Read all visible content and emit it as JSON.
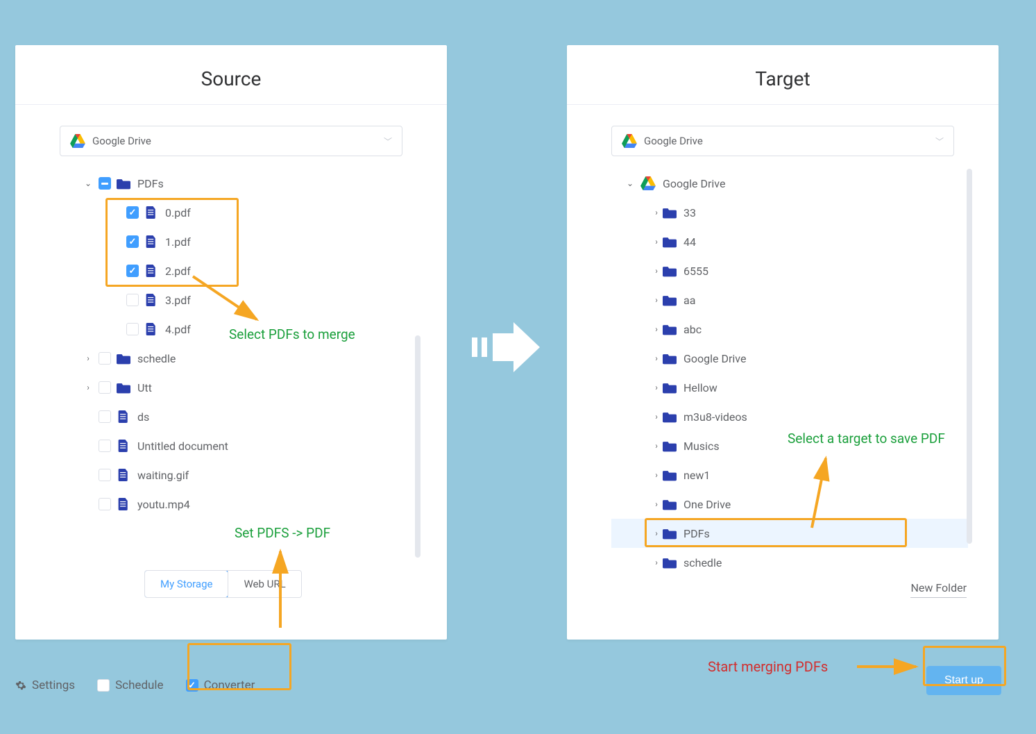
{
  "source": {
    "title": "Source",
    "dropdown": "Google Drive",
    "tree": {
      "root": {
        "name": "PDFs",
        "caret": "down",
        "cb": "indet"
      },
      "children": [
        {
          "name": "0.pdf",
          "cb": "checked",
          "type": "file"
        },
        {
          "name": "1.pdf",
          "cb": "checked",
          "type": "file"
        },
        {
          "name": "2.pdf",
          "cb": "checked",
          "type": "file"
        },
        {
          "name": "3.pdf",
          "cb": "",
          "type": "file"
        },
        {
          "name": "4.pdf",
          "cb": "",
          "type": "file"
        }
      ],
      "siblings": [
        {
          "name": "schedle",
          "caret": "right",
          "cb": "",
          "type": "folder"
        },
        {
          "name": "Utt",
          "caret": "right",
          "cb": "",
          "type": "folder"
        },
        {
          "name": "ds",
          "caret": "",
          "cb": "",
          "type": "file"
        },
        {
          "name": "Untitled document",
          "caret": "",
          "cb": "",
          "type": "file"
        },
        {
          "name": "waiting.gif",
          "caret": "",
          "cb": "",
          "type": "file"
        },
        {
          "name": "youtu.mp4",
          "caret": "",
          "cb": "",
          "type": "file"
        }
      ]
    },
    "tabs": {
      "active": "My Storage",
      "other": "Web URL"
    }
  },
  "target": {
    "title": "Target",
    "dropdown": "Google Drive",
    "root": "Google Drive",
    "folders": [
      "33",
      "44",
      "6555",
      "aa",
      "abc",
      "Google Drive",
      "Hellow",
      "m3u8-videos",
      "Musics",
      "new1",
      "One Drive",
      "PDFs",
      "schedle"
    ],
    "selected": "PDFs",
    "newfolder": "New Folder"
  },
  "footer": {
    "settings": "Settings",
    "schedule": "Schedule",
    "converter": "Converter"
  },
  "startup": "Start up",
  "annotations": {
    "selectPdfs": "Select PDFs to merge",
    "setPdfs": "Set PDFS -> PDF",
    "selectTarget": "Select a target to save PDF",
    "startMerge": "Start merging PDFs"
  }
}
